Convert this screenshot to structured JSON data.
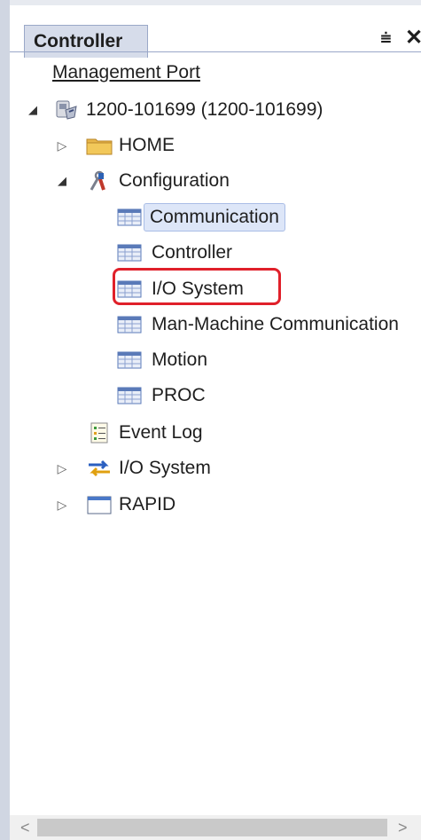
{
  "panel": {
    "tab_label": "Controller",
    "pin_glyph": "⩧",
    "close_glyph": "✕"
  },
  "tree": {
    "management_port": "Management Port",
    "controller_node": "1200-101699 (1200-101699)",
    "home": "HOME",
    "configuration": "Configuration",
    "config_items": [
      "Communication",
      "Controller",
      "I/O System",
      "Man-Machine Communication",
      "Motion",
      "PROC"
    ],
    "event_log": "Event Log",
    "io_system": "I/O System",
    "rapid": "RAPID"
  },
  "selected_item": "Communication",
  "highlighted_item": "I/O System",
  "scrollbar": {
    "left": "<",
    "right": ">"
  },
  "colors": {
    "highlight_box": "#e0202a",
    "selection_bg": "#dde6f8",
    "tab_bg": "#d6dcea"
  }
}
